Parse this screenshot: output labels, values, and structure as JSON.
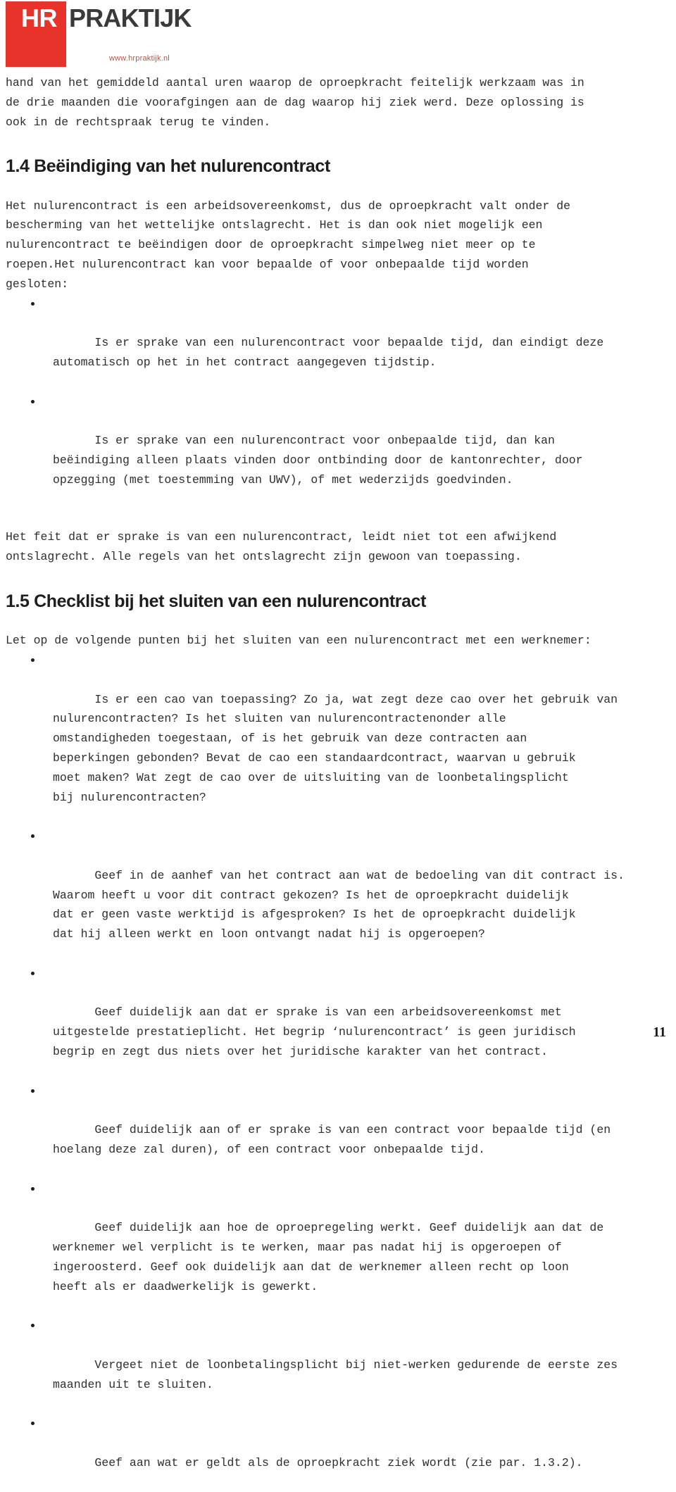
{
  "header": {
    "logo_mark_text": "HR",
    "logo_word": "PRAKTIJK",
    "logo_url": "www.hrpraktijk.nl",
    "brand_red": "#e8332a",
    "brand_dark": "#3a3a3a",
    "url_color": "#b4544a"
  },
  "content": {
    "intro_paragraph": "hand van het gemiddeld aantal uren waarop de oproepkracht feitelijk werkzaam was in\nde drie maanden die voorafgingen aan de dag waarop hij ziek werd. Deze oplossing is\nook in de rechtspraak terug te vinden.",
    "heading_1_4": "1.4 Beëindiging van het nulurencontract",
    "paragraph_1_4": "Het nulurencontract is een arbeidsovereenkomst, dus de oproepkracht valt onder de\nbescherming van het wettelijke ontslagrecht. Het is dan ook niet mogelijk een\nnulurencontract te beëindigen door de oproepkracht simpelweg niet meer op te\nroepen.Het nulurencontract kan voor bepaalde of voor onbepaalde tijd worden\ngesloten:",
    "bullets_1_4": [
      "Is er sprake van een nulurencontract voor bepaalde tijd, dan eindigt deze\nautomatisch op het in het contract aangegeven tijdstip.",
      "Is er sprake van een nulurencontract voor onbepaalde tijd, dan kan\nbeëindiging alleen plaats vinden door ontbinding door de kantonrechter, door\nopzegging (met toestemming van UWV), of met wederzijds goedvinden."
    ],
    "paragraph_1_4_closing": "Het feit dat er sprake is van een nulurencontract, leidt niet tot een afwijkend\nontslagrecht. Alle regels van het ontslagrecht zijn gewoon van toepassing.",
    "heading_1_5": "1.5 Checklist bij het sluiten van een nulurencontract",
    "paragraph_1_5": "Let op de volgende punten bij het sluiten van een nulurencontract met een werknemer:",
    "bullets_1_5": [
      "Is er een cao van toepassing? Zo ja, wat zegt deze cao over het gebruik van\nnulurencontracten? Is het sluiten van nulurencontractenonder alle\nomstandigheden toegestaan, of is het gebruik van deze contracten aan\nbeperkingen gebonden? Bevat de cao een standaardcontract, waarvan u gebruik\nmoet maken? Wat zegt de cao over de uitsluiting van de loonbetalingsplicht\nbij nulurencontracten?",
      "Geef in de aanhef van het contract aan wat de bedoeling van dit contract is.\nWaarom heeft u voor dit contract gekozen? Is het de oproepkracht duidelijk\ndat er geen vaste werktijd is afgesproken? Is het de oproepkracht duidelijk\ndat hij alleen werkt en loon ontvangt nadat hij is opgeroepen?",
      "Geef duidelijk aan dat er sprake is van een arbeidsovereenkomst met\nuitgestelde prestatieplicht. Het begrip ‘nulurencontract’ is geen juridisch\nbegrip en zegt dus niets over het juridische karakter van het contract.",
      "Geef duidelijk aan of er sprake is van een contract voor bepaalde tijd (en\nhoelang deze zal duren), of een contract voor onbepaalde tijd.",
      "Geef duidelijk aan hoe de oproepregeling werkt. Geef duidelijk aan dat de\nwerknemer wel verplicht is te werken, maar pas nadat hij is opgeroepen of\ningeroosterd. Geef ook duidelijk aan dat de werknemer alleen recht op loon\nheeft als er daadwerkelijk is gewerkt.",
      "Vergeet niet de loonbetalingsplicht bij niet-werken gedurende de eerste zes\nmaanden uit te sluiten.",
      "Geef aan wat er geldt als de oproepkracht ziek wordt (zie par. 1.3.2)."
    ]
  },
  "footer": {
    "page_number": "11"
  }
}
